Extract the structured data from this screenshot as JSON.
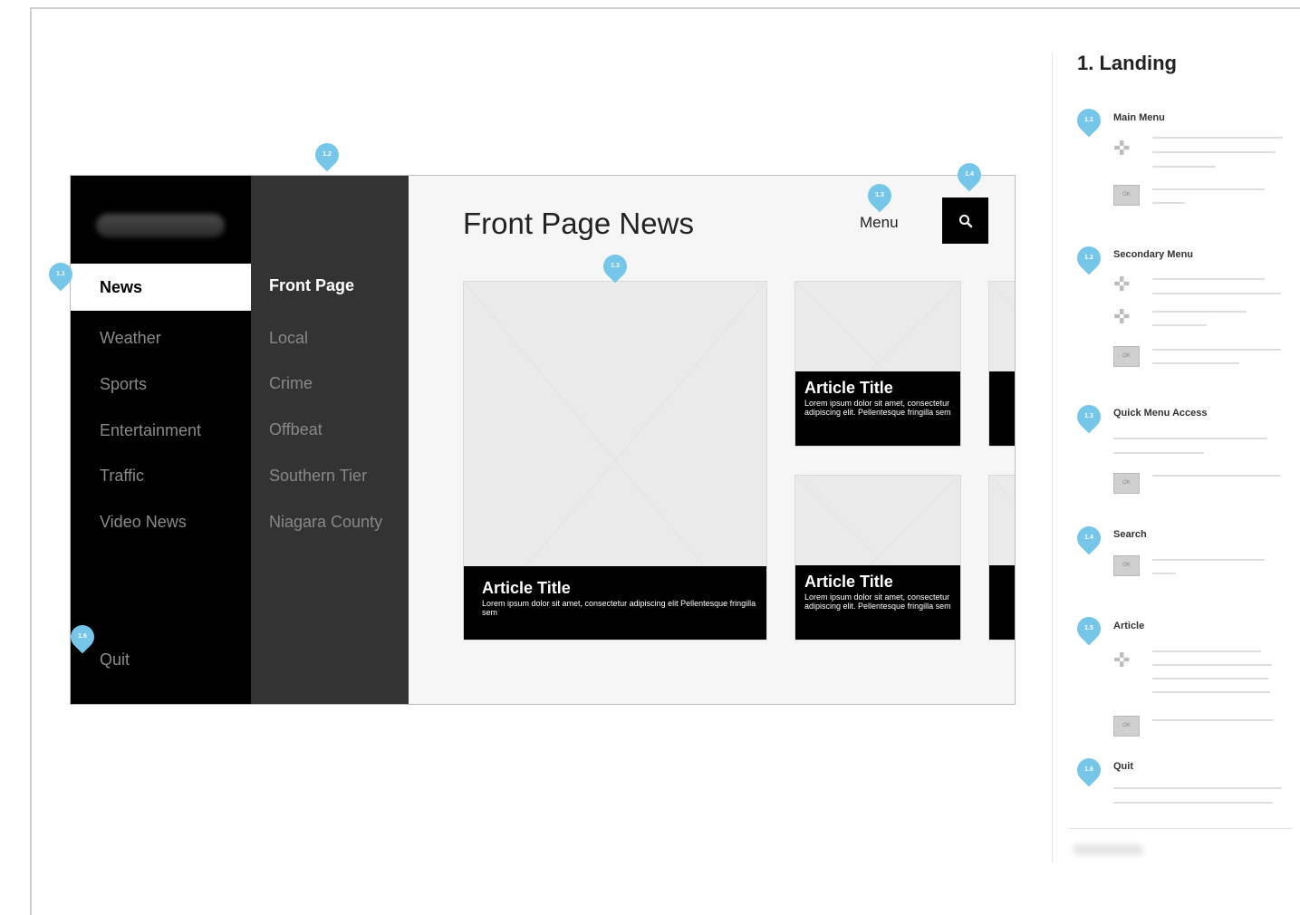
{
  "screen": {
    "main_menu": {
      "items": [
        {
          "label": "News",
          "active": true
        },
        {
          "label": "Weather"
        },
        {
          "label": "Sports"
        },
        {
          "label": "Entertainment"
        },
        {
          "label": "Traffic"
        },
        {
          "label": "Video News"
        }
      ],
      "quit_label": "Quit"
    },
    "sub_menu": {
      "items": [
        {
          "label": "Front Page",
          "active": true
        },
        {
          "label": "Local"
        },
        {
          "label": "Crime"
        },
        {
          "label": "Offbeat"
        },
        {
          "label": "Southern Tier"
        },
        {
          "label": "Niagara County"
        }
      ]
    },
    "content": {
      "title": "Front Page News",
      "menu_label": "Menu",
      "articles": [
        {
          "title": "Article Title",
          "desc": "Lorem ipsum dolor sit amet, consectetur adipiscing elit Pellentesque fringilla sem"
        },
        {
          "title": "Article Title",
          "desc": "Lorem ipsum dolor sit amet, consectetur adipiscing elit. Pellentesque fringilla sem"
        },
        {
          "title": "Article Title",
          "desc": "Lorem ipsum dolor sit amet, consectetur adipiscing elit. Pellentesque fringilla sem"
        }
      ]
    }
  },
  "pins": {
    "main_menu": "1.1",
    "secondary_menu": "1.2",
    "article": "1.3",
    "quick_menu": "1.3",
    "search": "1.4",
    "quit": "1.6"
  },
  "annotations": {
    "title": "1. Landing",
    "sections": [
      {
        "pin": "1.1",
        "heading": "Main Menu"
      },
      {
        "pin": "1.2",
        "heading": "Secondary Menu"
      },
      {
        "pin": "1.3",
        "heading": "Quick Menu Access"
      },
      {
        "pin": "1.4",
        "heading": "Search"
      },
      {
        "pin": "1.5",
        "heading": "Article"
      },
      {
        "pin": "1.6",
        "heading": "Quit"
      }
    ],
    "ok_label": "OK"
  },
  "colors": {
    "pin": "#76c6ea",
    "main_menu_bg": "#000000",
    "sub_menu_bg": "#333333",
    "content_bg": "#f6f6f6"
  }
}
